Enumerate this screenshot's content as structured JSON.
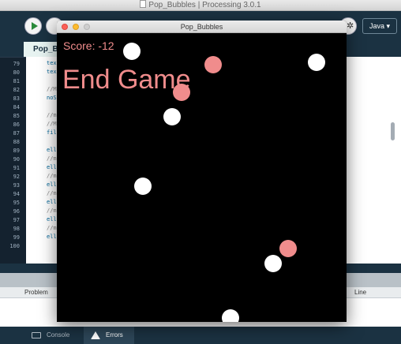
{
  "ide": {
    "title": "Pop_Bubbles | Processing 3.0.1",
    "mode": "Java ▾",
    "tab_label": "Pop_Bubbles",
    "line_numbers": [
      "79",
      "80",
      "81",
      "82",
      "83",
      "84",
      "85",
      "86",
      "87",
      "88",
      "89",
      "90",
      "91",
      "92",
      "93",
      "94",
      "95",
      "96",
      "97",
      "98",
      "99",
      "100"
    ],
    "code_lines": [
      "textS",
      "text(",
      "",
      "//Mak",
      "noStr",
      "",
      "//mak",
      "//Mak",
      "fill(",
      "",
      "ellip",
      "//mak",
      "ellip",
      "//mak",
      "ellip",
      "//mak",
      "ellip",
      "//mak",
      "ellip",
      "//mak",
      "ellip",
      ""
    ],
    "errors_columns": {
      "problem": "Problem",
      "line": "Line"
    },
    "bottom_tabs": {
      "console": "Console",
      "errors": "Errors"
    },
    "icons": {
      "run": "play-icon",
      "stop": "stop-icon",
      "debug": "debug-icon",
      "console": "console-icon",
      "errors": "warning-icon"
    }
  },
  "sketch": {
    "window_title": "Pop_Bubbles",
    "score_text": "Score: -12",
    "end_text": "End Game",
    "colors": {
      "text": "#f08c8c",
      "bubble_white": "#ffffff",
      "bubble_pink": "#f08c8c",
      "background": "#000000"
    }
  }
}
